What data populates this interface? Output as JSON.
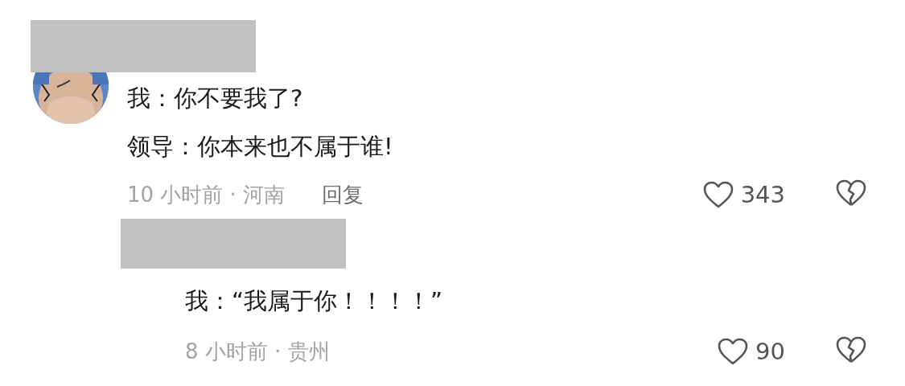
{
  "comments": [
    {
      "name": {
        "kind": "redacted"
      },
      "avatar": {
        "kind": "picture"
      },
      "lines": [
        "我：你不要我了?",
        "领导：你本来也不属于谁!"
      ],
      "meta": "10 小时前 · 河南",
      "reply_label": "回复",
      "likes": "343",
      "replies": [
        {
          "name": {
            "kind": "redacted"
          },
          "lines": [
            "我：“我属于你！！！！”"
          ],
          "meta": "8 小时前 · 贵州",
          "likes": "90"
        }
      ]
    }
  ]
}
